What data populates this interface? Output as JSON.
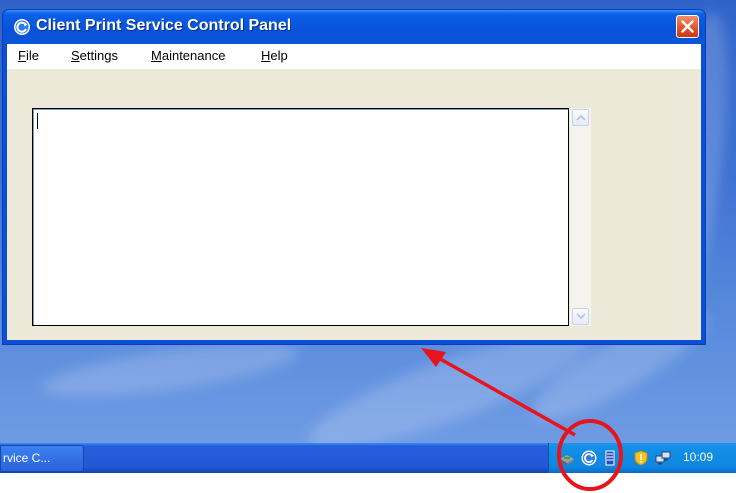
{
  "window": {
    "title": "Client Print Service Control Panel",
    "close_icon": "close-icon",
    "app_icon": "client-print-service-icon"
  },
  "menubar": {
    "items": [
      {
        "label": "File"
      },
      {
        "label": "Settings"
      },
      {
        "label": "Maintenance"
      },
      {
        "label": "Help"
      }
    ]
  },
  "log": {
    "value": ""
  },
  "taskbar": {
    "task_button_label": "rvice C...",
    "clock": "10:09",
    "tray_icons": [
      "network-icon",
      "client-print-service-icon",
      "printer-queue-icon",
      "security-shield-icon",
      "network-connections-icon"
    ]
  },
  "colors": {
    "annotation": "#e8141c",
    "title_bar": "#0a5fe8",
    "window_bg": "#ece9d8"
  }
}
